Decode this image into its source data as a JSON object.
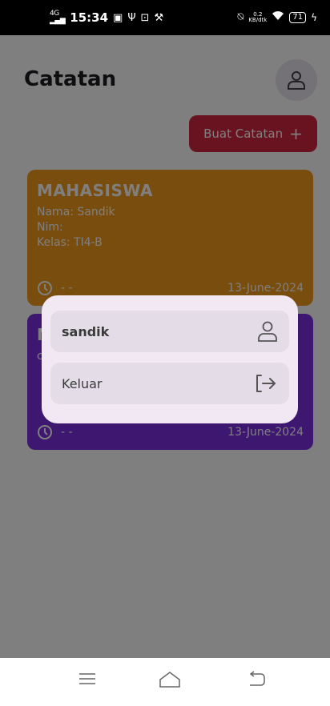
{
  "status_bar": {
    "network_type": "4G",
    "time": "15:34",
    "data_speed_value": "0.2",
    "data_speed_unit": "KB/dtk",
    "battery": "71"
  },
  "header": {
    "title": "Catatan"
  },
  "actions": {
    "create_label": "Buat Catatan",
    "create_icon": "+"
  },
  "notes": [
    {
      "title": "MAHASISWA",
      "lines": [
        "Nama: Sandik",
        "Nim:",
        "Kelas: TI4-B"
      ],
      "time": "- -",
      "date": "13-June-2024",
      "color": "#f29a1c"
    },
    {
      "title": "M",
      "lines": [
        "c"
      ],
      "time": "- -",
      "date": "13-June-2024",
      "color": "#7b2fe0"
    }
  ],
  "menu": {
    "user_label": "sandik",
    "logout_label": "Keluar"
  },
  "colors": {
    "accent": "#d32440",
    "scrim": "rgba(0,0,0,0.5)",
    "menu_bg": "#f1e8f4"
  }
}
